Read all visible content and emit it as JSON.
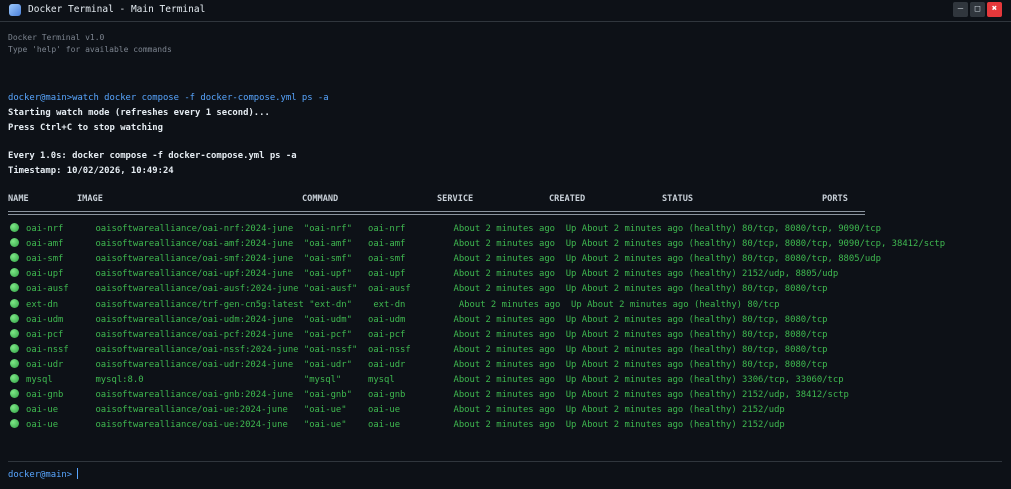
{
  "window": {
    "title": "Docker Terminal - Main Terminal",
    "icon": "docker-whale-icon",
    "controls": {
      "minimize": "—",
      "maximize": "□",
      "close": "✖"
    }
  },
  "banner": [
    "Docker Terminal v1.0",
    "Type 'help' for available commands"
  ],
  "prompt": "docker@main>",
  "command": "watch docker compose -f docker-compose.yml ps -a",
  "output": [
    "Starting watch mode (refreshes every 1 second)...",
    "Press Ctrl+C to stop watching",
    "Every 1.0s: docker compose -f docker-compose.yml ps -a",
    "Timestamp: 10/02/2026, 10:49:24"
  ],
  "table": {
    "headers": [
      "NAME",
      "IMAGE",
      "COMMAND",
      "SERVICE",
      "CREATED",
      "STATUS",
      "PORTS"
    ],
    "rows": [
      [
        "oai-nrf",
        "oaisoftwarealliance/oai-nrf:2024-june",
        "\"oai-nrf\"",
        "oai-nrf",
        "About 2 minutes ago",
        "Up About 2 minutes ago (healthy)",
        "80/tcp, 8080/tcp, 9090/tcp"
      ],
      [
        "oai-amf",
        "oaisoftwarealliance/oai-amf:2024-june",
        "\"oai-amf\"",
        "oai-amf",
        "About 2 minutes ago",
        "Up About 2 minutes ago (healthy)",
        "80/tcp, 8080/tcp, 9090/tcp, 38412/sctp"
      ],
      [
        "oai-smf",
        "oaisoftwarealliance/oai-smf:2024-june",
        "\"oai-smf\"",
        "oai-smf",
        "About 2 minutes ago",
        "Up About 2 minutes ago (healthy)",
        "80/tcp, 8080/tcp, 8805/udp"
      ],
      [
        "oai-upf",
        "oaisoftwarealliance/oai-upf:2024-june",
        "\"oai-upf\"",
        "oai-upf",
        "About 2 minutes ago",
        "Up About 2 minutes ago (healthy)",
        "2152/udp, 8805/udp"
      ],
      [
        "oai-ausf",
        "oaisoftwarealliance/oai-ausf:2024-june",
        "\"oai-ausf\"",
        "oai-ausf",
        "About 2 minutes ago",
        "Up About 2 minutes ago (healthy)",
        "80/tcp, 8080/tcp"
      ],
      [
        "ext-dn",
        "oaisoftwarealliance/trf-gen-cn5g:latest",
        "\"ext-dn\"",
        "ext-dn",
        "About 2 minutes ago",
        "Up About 2 minutes ago (healthy)",
        "80/tcp"
      ],
      [
        "oai-udm",
        "oaisoftwarealliance/oai-udm:2024-june",
        "\"oai-udm\"",
        "oai-udm",
        "About 2 minutes ago",
        "Up About 2 minutes ago (healthy)",
        "80/tcp, 8080/tcp"
      ],
      [
        "oai-pcf",
        "oaisoftwarealliance/oai-pcf:2024-june",
        "\"oai-pcf\"",
        "oai-pcf",
        "About 2 minutes ago",
        "Up About 2 minutes ago (healthy)",
        "80/tcp, 8080/tcp"
      ],
      [
        "oai-nssf",
        "oaisoftwarealliance/oai-nssf:2024-june",
        "\"oai-nssf\"",
        "oai-nssf",
        "About 2 minutes ago",
        "Up About 2 minutes ago (healthy)",
        "80/tcp, 8080/tcp"
      ],
      [
        "oai-udr",
        "oaisoftwarealliance/oai-udr:2024-june",
        "\"oai-udr\"",
        "oai-udr",
        "About 2 minutes ago",
        "Up About 2 minutes ago (healthy)",
        "80/tcp, 8080/tcp"
      ],
      [
        "mysql",
        "mysql:8.0",
        "\"mysql\"",
        "mysql",
        "About 2 minutes ago",
        "Up About 2 minutes ago (healthy)",
        "3306/tcp, 33060/tcp"
      ],
      [
        "oai-gnb",
        "oaisoftwarealliance/oai-gnb:2024-june",
        "\"oai-gnb\"",
        "oai-gnb",
        "About 2 minutes ago",
        "Up About 2 minutes ago (healthy)",
        "2152/udp, 38412/sctp"
      ],
      [
        "oai-ue",
        "oaisoftwarealliance/oai-ue:2024-june",
        "\"oai-ue\"",
        "oai-ue",
        "About 2 minutes ago",
        "Up About 2 minutes ago (healthy)",
        "2152/udp"
      ],
      [
        "oai-ue",
        "oaisoftwarealliance/oai-ue:2024-june",
        "\"oai-ue\"",
        "oai-ue",
        "About 2 minutes ago",
        "Up About 2 minutes ago (healthy)",
        "2152/udp"
      ]
    ],
    "status_color": "#3fb950"
  },
  "input": {
    "prompt": "docker@main>",
    "value": ""
  }
}
